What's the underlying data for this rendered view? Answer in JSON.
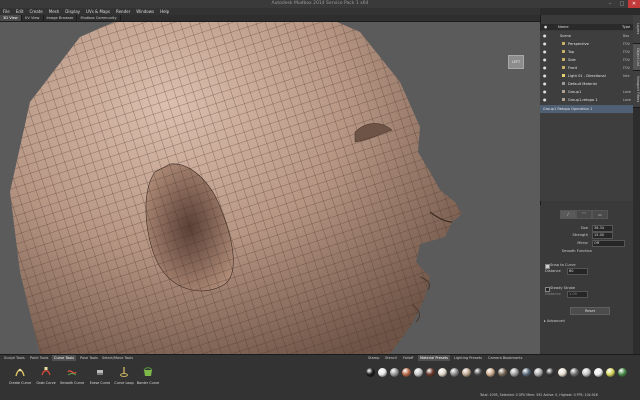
{
  "window": {
    "title": "Autodesk Mudbox 2014 Service Pack 1 x64",
    "minimize": "–",
    "maximize": "□",
    "close": "✕"
  },
  "menu": [
    "File",
    "Edit",
    "Create",
    "Mesh",
    "Display",
    "UVs & Maps",
    "Render",
    "Windows",
    "Help"
  ],
  "view_tabs": [
    {
      "label": "3D View",
      "active": true
    },
    {
      "label": "UV View",
      "active": false
    },
    {
      "label": "Image Browser",
      "active": false
    },
    {
      "label": "Mudbox Community",
      "active": false
    }
  ],
  "viewcube": {
    "label": "LEFT"
  },
  "side_tabs": [
    "Layers",
    "Object List",
    "Viewport Filters"
  ],
  "outliner": {
    "headers": {
      "visible": "●",
      "name": "Name",
      "type": "Type"
    },
    "rows": [
      {
        "label": "Scene",
        "type": "Bas",
        "indent": 0,
        "selected": false
      },
      {
        "label": "Perspective",
        "type": "FOV",
        "indent": 1,
        "selected": false
      },
      {
        "label": "Top",
        "type": "FOV",
        "indent": 1,
        "selected": false
      },
      {
        "label": "Side",
        "type": "FOV",
        "indent": 1,
        "selected": false
      },
      {
        "label": "Front",
        "type": "FOV",
        "indent": 1,
        "selected": false
      },
      {
        "label": "Light 01 - Directional",
        "type": "Inte",
        "indent": 1,
        "selected": false
      },
      {
        "label": "Default Material",
        "type": "",
        "indent": 1,
        "selected": false
      },
      {
        "label": "Group1",
        "type": "Leve",
        "indent": 1,
        "selected": false
      },
      {
        "label": "Group1-retopo 1",
        "type": "Leve",
        "indent": 1,
        "selected": false
      },
      {
        "label": "Group1 Retopo Operation 1",
        "type": "",
        "indent": 0,
        "selected": true
      }
    ]
  },
  "properties": {
    "tool_buttons": [
      "⁄",
      "⌒",
      "▭"
    ],
    "size": {
      "label": "Size",
      "value": "36.34"
    },
    "strength": {
      "label": "Strength",
      "value": "15.00"
    },
    "mirror": {
      "label": "Mirror",
      "value": "Off"
    },
    "smooth_function": {
      "label": "Smooth Function"
    },
    "snap_to_curve": {
      "label": "Snap to Curve",
      "checked": true
    },
    "distance": {
      "label": "Distance",
      "value": "60"
    },
    "steady_stroke": {
      "label": "Steady Stroke",
      "checked": false
    },
    "steady_distance": {
      "label": "Distance",
      "value": "1.00"
    },
    "reset_label": "Reset",
    "advanced_label": "Advanced"
  },
  "bottom_tabs": {
    "left": [
      {
        "label": "Sculpt Tools",
        "active": false
      },
      {
        "label": "Paint Tools",
        "active": false
      },
      {
        "label": "Curve Tools",
        "active": true
      },
      {
        "label": "Pose Tools",
        "active": false
      },
      {
        "label": "Select/Move Tools",
        "active": false
      }
    ],
    "right": [
      {
        "label": "Stamp",
        "active": false
      },
      {
        "label": "Stencil",
        "active": false
      },
      {
        "label": "Falloff",
        "active": false
      },
      {
        "label": "Material Presets",
        "active": true
      },
      {
        "label": "Lighting Presets",
        "active": false
      },
      {
        "label": "Camera Bookmarks",
        "active": false
      }
    ]
  },
  "curve_tools": [
    {
      "label": "Create Curve",
      "icon": "create-curve-icon",
      "color": "#d8c060"
    },
    {
      "label": "Grab Curve",
      "icon": "grab-curve-icon",
      "color": "#c84a3a"
    },
    {
      "label": "Smooth Curve",
      "icon": "smooth-curve-icon",
      "color": "#d05040"
    },
    {
      "label": "Erase Curve",
      "icon": "erase-curve-icon",
      "color": "#bbbbbb"
    },
    {
      "label": "Curve Loop",
      "icon": "curve-loop-icon",
      "color": "#c8b060"
    },
    {
      "label": "Border Curve",
      "icon": "border-curve-icon",
      "color": "#7cb84a"
    }
  ],
  "materials": [
    "#1a1a1a",
    "#e8e8e8",
    "#9a9a9a",
    "#b86a4a",
    "#c8c8c8",
    "#6a3a2a",
    "#e0d8c8",
    "#8a8a8a",
    "#c0a890",
    "#4a4a4a",
    "#d0b090",
    "#7a6a5a",
    "#a0a0a0",
    "#5a6a7a",
    "#b0b0b0",
    "#3a3a3a",
    "#e8e0d0",
    "#707070",
    "#c8c8c8",
    "#f0f0f0",
    "#d8d860",
    "#4a8a4a"
  ],
  "status": "Total: 1095, Selected: 0 GPU Mem: 592 Active: 0, Highest: 0 FPS: 104.926"
}
